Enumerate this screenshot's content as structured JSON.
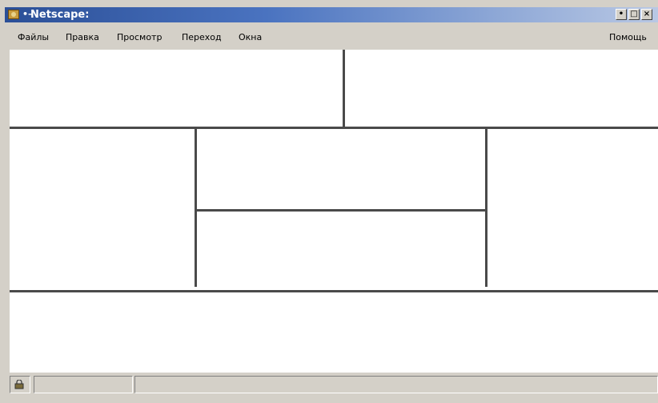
{
  "window": {
    "title": "Netscape:",
    "title_separator": "•–",
    "controls": {
      "minimize": "•",
      "maximize": "□",
      "close": "×"
    }
  },
  "menubar": {
    "items": [
      "Файлы",
      "Правка",
      "Просмотр",
      "Переход",
      "Окна"
    ],
    "help": "Помощь"
  },
  "statusbar": {
    "security_icon": "lock-icon",
    "progress_text": "",
    "status_text": ""
  },
  "colors": {
    "titlebar_start": "#2b4f97",
    "titlebar_end": "#b9c8e4",
    "chrome": "#d4d0c8",
    "frame_border": "#4a4a4a",
    "content_bg": "#ffffff"
  }
}
